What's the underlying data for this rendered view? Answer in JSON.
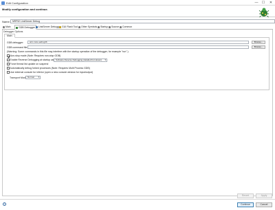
{
  "window": {
    "title": "Edit Configuration",
    "minimize": "—",
    "maximize": "☐",
    "close": "✕"
  },
  "header": {
    "heading": "Modify configuration and continue."
  },
  "name": {
    "label": "Name:",
    "value": "NRF52 LinkServer Debug"
  },
  "tabs": [
    {
      "label": "Main"
    },
    {
      "label": "GDB Debugger"
    },
    {
      "label": "LinkServer Debugger"
    },
    {
      "label": "GUI Flash Tool"
    },
    {
      "label": "Other Symbols"
    },
    {
      "label": "Startup"
    },
    {
      "label": "Source"
    },
    {
      "label": "Common"
    }
  ],
  "debugger_options": {
    "title": "Debugger Options",
    "subtab": "Main",
    "gdb_debugger_label": "GDB debugger:",
    "gdb_debugger_value": "arm-none-eabi-gdb",
    "browse_label": "Browse...",
    "gdb_command_file_label": "GDB command file:",
    "gdb_command_file_value": "",
    "warning": "(Warning: Some commands in this file may interfere with the startup operation of the debugger, for example \"run\".)",
    "options": [
      {
        "label": "Non-stop mode (Note: Requires non-stop GDB)",
        "checked": true
      },
      {
        "label": "Enable Reverse Debugging at startup using:",
        "checked": false
      },
      {
        "label": "Force thread list update on suspend",
        "checked": false
      },
      {
        "label": "Automatically debug forked processes (Note: Requires Multi Process GDB)",
        "checked": false
      },
      {
        "label": "Use external console for inferior (open a new console window for input/output)",
        "checked": false
      }
    ],
    "reverse_mode_value": "Software Reverse Debugging (detailed but slower)",
    "transport_label": "Transport Mode:",
    "transport_value": "Normal"
  },
  "buttons": {
    "revert": "Revert",
    "apply": "Apply",
    "continue": "Continue",
    "cancel": "Cancel"
  },
  "help_label": "?"
}
